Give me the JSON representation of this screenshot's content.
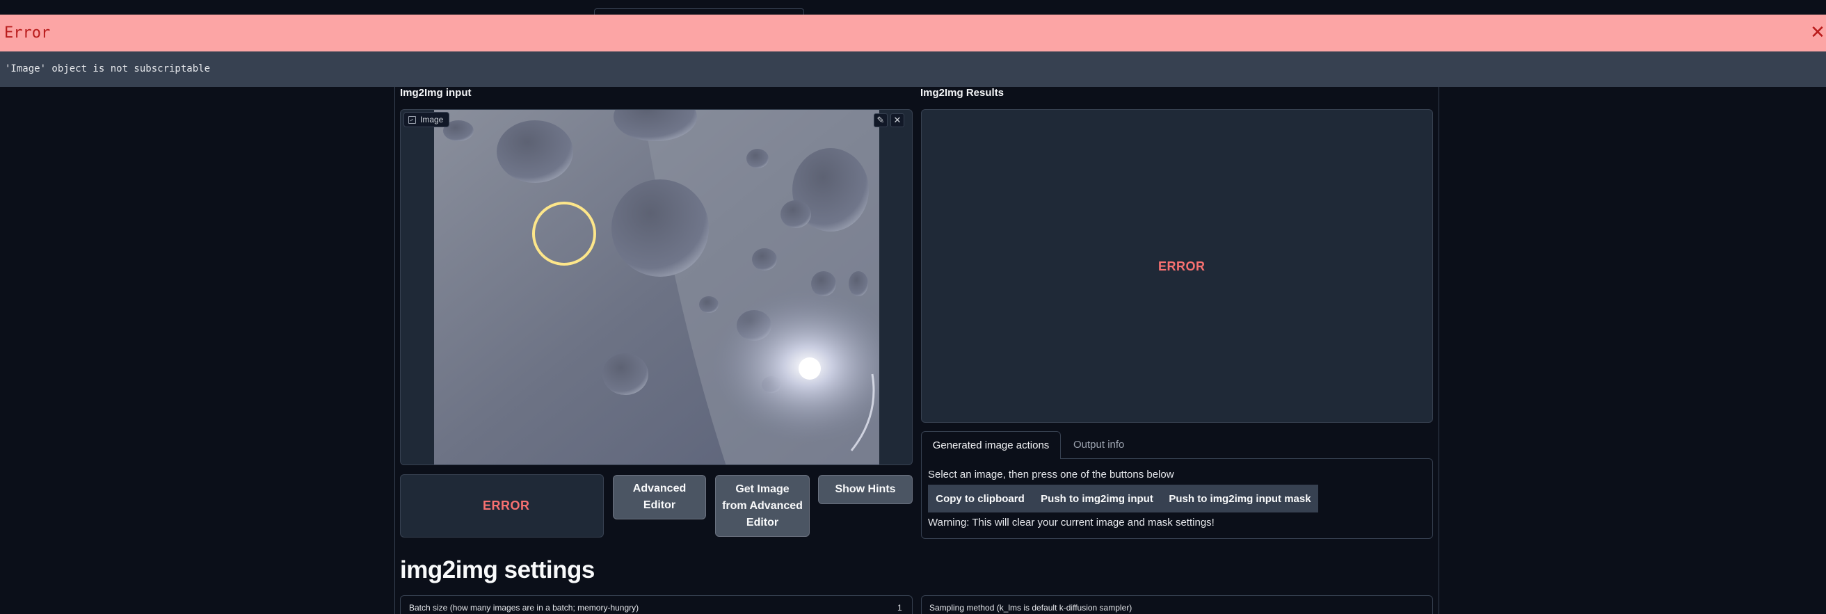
{
  "error_banner": {
    "title": "Error",
    "close": "✕",
    "message": "'Image' object is not subscriptable"
  },
  "input_section": {
    "label": "Img2Img input",
    "image_chip": "Image",
    "edit_icon": "✎",
    "clear_icon": "✕"
  },
  "results_section": {
    "label": "Img2Img Results",
    "status": "ERROR"
  },
  "action_row": {
    "status": "ERROR",
    "advanced_editor": [
      "Advanced",
      "Editor"
    ],
    "get_image": [
      "Get Image",
      "from Advanced",
      "Editor"
    ],
    "show_hints": "Show Hints"
  },
  "tabs": {
    "active": "Generated image actions",
    "inactive": "Output info"
  },
  "actions_panel": {
    "instruction": "Select an image, then press one of the buttons below",
    "copy": "Copy to clipboard",
    "push_input": "Push to img2img input",
    "push_mask": "Push to img2img input mask",
    "warning": "Warning: This will clear your current image and mask settings!"
  },
  "settings": {
    "title": "img2img settings",
    "batch_size_label": "Batch size (how many images are in a batch; memory-hungry)",
    "batch_size_value": "1",
    "sampling_label": "Sampling method (k_lms is default k-diffusion sampler)"
  }
}
